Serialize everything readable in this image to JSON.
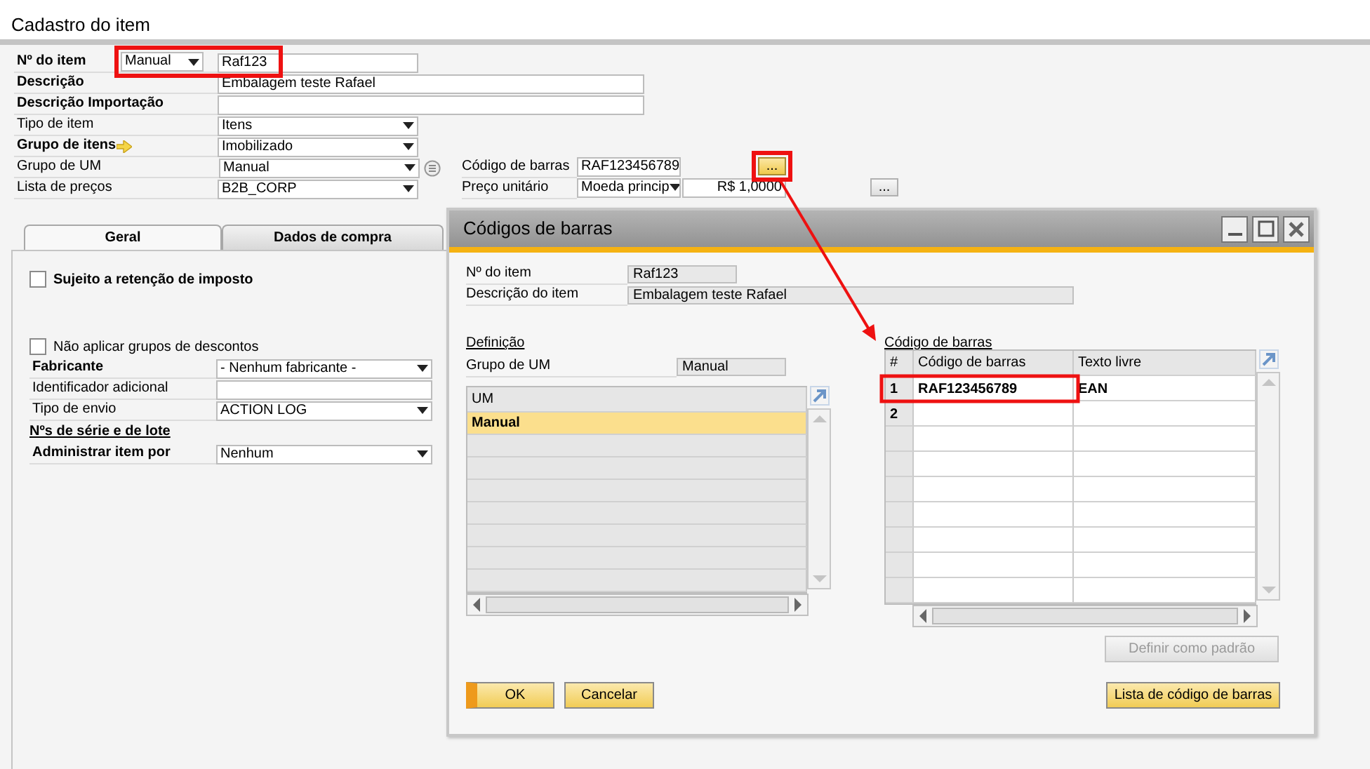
{
  "window": {
    "title": "Cadastro do item"
  },
  "header_fields": [
    {
      "label": "Nº do item",
      "bold": true,
      "kind": "series",
      "series": "Manual",
      "value": "Raf123"
    },
    {
      "label": "Descrição",
      "bold": true,
      "kind": "wide",
      "value": "Embalagem teste Rafael"
    },
    {
      "label": "Descrição Importação",
      "bold": true,
      "kind": "wide"
    },
    {
      "label": "Tipo de item",
      "bold": false,
      "kind": "select",
      "value": "Itens"
    },
    {
      "label": "Grupo de itens",
      "bold": true,
      "kind": "select",
      "value": "Imobilizado",
      "link_arrow": true
    },
    {
      "label": "Grupo de UM",
      "bold": false,
      "kind": "select",
      "value": "Manual",
      "detail_icon": true
    },
    {
      "label": "Lista de preços",
      "bold": false,
      "kind": "select",
      "value": "B2B_CORP"
    }
  ],
  "right_fields": [
    {
      "label": "Código de barras",
      "kind": "text",
      "value": "RAF123456789",
      "button": "...",
      "highlighted": true
    },
    {
      "label": "Preço unitário",
      "kind": "price",
      "currency": "Moeda princip",
      "value": "R$ 1,0000",
      "button": "...",
      "highlighted": false
    }
  ],
  "tabs": [
    {
      "label": "Geral",
      "selected": true
    },
    {
      "label": "Dados de compra",
      "selected": false
    }
  ],
  "general_tab": [
    {
      "kind": "checkbox",
      "label": "Sujeito a retenção de imposto",
      "bold": true,
      "checked": false
    },
    {
      "kind": "checkbox",
      "label": "Não aplicar grupos de descontos",
      "bold": false,
      "checked": false
    },
    {
      "kind": "select",
      "label": "Fabricante",
      "bold": true,
      "value": "- Nenhum fabricante -"
    },
    {
      "kind": "text",
      "label": "Identificador adicional",
      "bold": false
    },
    {
      "kind": "select",
      "label": "Tipo de envio",
      "bold": false,
      "value": "ACTION LOG"
    },
    {
      "kind": "heading",
      "label": "Nºs de série e de lote"
    },
    {
      "kind": "select",
      "label": "Administrar item por",
      "bold": true,
      "value": "Nenhum"
    }
  ],
  "dialog": {
    "title": "Códigos de barras",
    "fields": [
      {
        "label": "Nº do item",
        "value": "Raf123"
      },
      {
        "label": "Descrição do item",
        "value": "Embalagem teste Rafael"
      }
    ],
    "definition": {
      "heading": "Definição",
      "field": {
        "label": "Grupo de UM",
        "value": "Manual"
      },
      "table": {
        "columns": [
          "UM"
        ],
        "rows": [
          {
            "cells": [
              "Manual"
            ],
            "selected": true
          }
        ]
      }
    },
    "barcodes": {
      "heading": "Código de barras",
      "table": {
        "columns": [
          "#",
          "Código de barras",
          "Texto livre"
        ],
        "rows": [
          {
            "cells": [
              "1",
              "RAF123456789",
              "EAN"
            ]
          },
          {
            "cells": [
              "2"
            ]
          }
        ]
      }
    },
    "default_button": {
      "label": "Definir como padrão",
      "disabled": true
    },
    "footer_buttons": [
      {
        "label": "OK",
        "primary": true
      },
      {
        "label": "Cancelar",
        "primary": false
      }
    ],
    "list_button": {
      "label": "Lista de código de barras"
    }
  }
}
